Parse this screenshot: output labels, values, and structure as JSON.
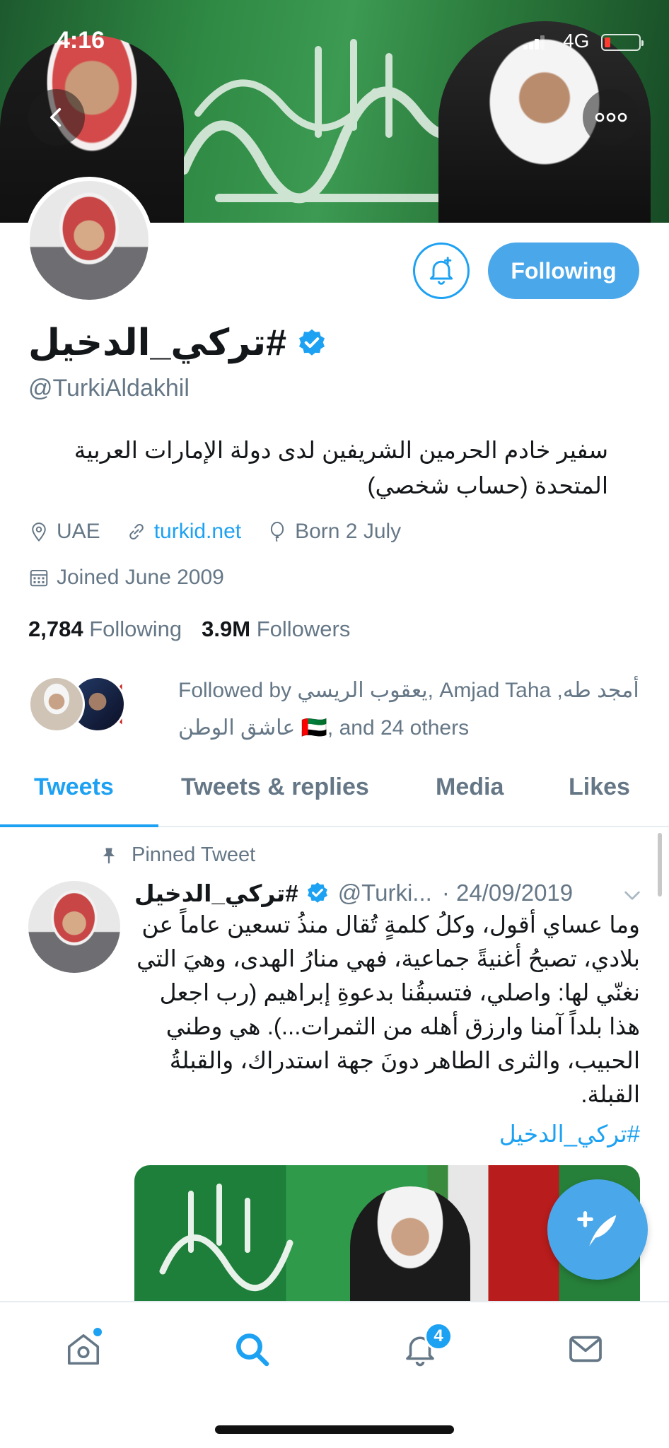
{
  "status_bar": {
    "time": "4:16",
    "network": "4G"
  },
  "profile": {
    "display_name": "#تركي_الدخيل",
    "handle": "@TurkiAldakhil",
    "bio": "سفير خادم الحرمين الشريفين لدى دولة الإمارات العربية المتحدة (حساب شخصي)",
    "location": "UAE",
    "website": "turkid.net",
    "birthday": "Born 2 July",
    "joined": "Joined June 2009",
    "following_count": "2,784",
    "following_label": "Following",
    "followers_count": "3.9M",
    "followers_label": "Followers",
    "followed_by": "Followed by يعقوب الريسي, Amjad Taha أمجد طه, عاشق الوطن 🇦🇪, and 24 others",
    "follow_button_label": "Following"
  },
  "tabs": [
    {
      "label": "Tweets",
      "active": true
    },
    {
      "label": "Tweets & replies",
      "active": false
    },
    {
      "label": "Media",
      "active": false
    },
    {
      "label": "Likes",
      "active": false
    }
  ],
  "tweet": {
    "pinned_label": "Pinned Tweet",
    "author_name": "#تركي_الدخيل",
    "author_handle": "@Turki...",
    "date": "· 24/09/2019",
    "text": "وما عساي أقول، وكلُ كلمةٍ تُقال منذُ تسعين عاماً عن بلادي، تصبحُ أغنيةً جماعية، فهي منارُ الهدى، وهيَ التي نغنّي لها: واصلي، فتسبقُنا بدعوةِ إبراهيم (رب اجعل هذا بلداً آمنا وارزق أهله من الثمرات...). هي وطني الحبيب، والثرى الطاهر دونَ جهة استدراك، والقبلةُ القبلة.",
    "hashtag": "#تركي_الدخيل"
  },
  "bottom_nav": {
    "notification_count": "4"
  },
  "colors": {
    "accent": "#1da1f2",
    "button_fill": "#4aa7ea",
    "secondary_text": "#657786"
  }
}
